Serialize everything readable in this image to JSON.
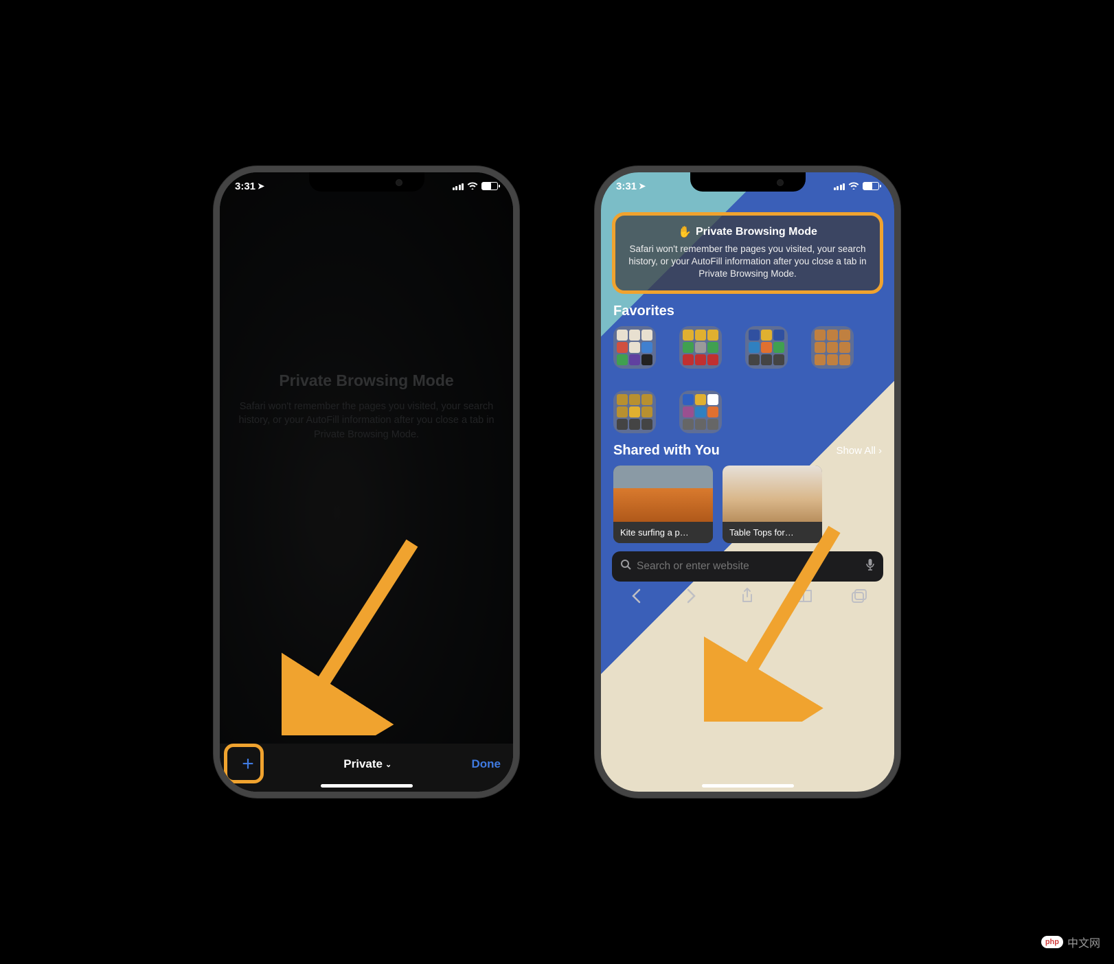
{
  "statusbar": {
    "time": "3:31"
  },
  "phone1": {
    "title": "Private Browsing Mode",
    "description": "Safari won't remember the pages you visited, your search history, or your AutoFill information after you close a tab in Private Browsing Mode.",
    "bottom": {
      "private_label": "Private",
      "done_label": "Done"
    }
  },
  "phone2": {
    "card": {
      "title": "Private Browsing Mode",
      "description": "Safari won't remember the pages you visited, your search history, or your AutoFill information after you close a tab in Private Browsing Mode."
    },
    "favorites_title": "Favorites",
    "shared": {
      "title": "Shared with You",
      "show_all": "Show All",
      "items": [
        {
          "label": "Kite surfing a p…"
        },
        {
          "label": "Table Tops for…"
        }
      ]
    },
    "search": {
      "placeholder": "Search or enter website"
    }
  },
  "watermark": {
    "badge": "php",
    "text": "中文网"
  }
}
